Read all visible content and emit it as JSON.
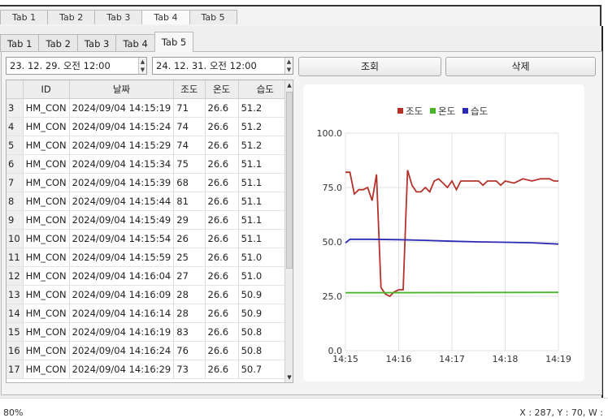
{
  "bg_tabs": [
    "Tab 1",
    "Tab 2",
    "Tab 3",
    "Tab 4",
    "Tab 5"
  ],
  "tabs": [
    "Tab 1",
    "Tab 2",
    "Tab 3",
    "Tab 4",
    "Tab 5"
  ],
  "active_tab": "Tab 5",
  "date_from": "23. 12. 29. 오전 12:00",
  "date_to": "24. 12. 31. 오전 12:00",
  "buttons": {
    "query": "조회",
    "delete": "삭제"
  },
  "table": {
    "columns": [
      "",
      "ID",
      "날짜",
      "조도",
      "온도",
      "습도"
    ],
    "rows": [
      [
        "3",
        "HM_CON",
        "2024/09/04 14:15:19",
        "71",
        "26.6",
        "51.2"
      ],
      [
        "4",
        "HM_CON",
        "2024/09/04 14:15:24",
        "74",
        "26.6",
        "51.2"
      ],
      [
        "5",
        "HM_CON",
        "2024/09/04 14:15:29",
        "74",
        "26.6",
        "51.2"
      ],
      [
        "6",
        "HM_CON",
        "2024/09/04 14:15:34",
        "75",
        "26.6",
        "51.1"
      ],
      [
        "7",
        "HM_CON",
        "2024/09/04 14:15:39",
        "68",
        "26.6",
        "51.1"
      ],
      [
        "8",
        "HM_CON",
        "2024/09/04 14:15:44",
        "81",
        "26.6",
        "51.1"
      ],
      [
        "9",
        "HM_CON",
        "2024/09/04 14:15:49",
        "29",
        "26.6",
        "51.1"
      ],
      [
        "10",
        "HM_CON",
        "2024/09/04 14:15:54",
        "26",
        "26.6",
        "51.1"
      ],
      [
        "11",
        "HM_CON",
        "2024/09/04 14:15:59",
        "25",
        "26.6",
        "51.0"
      ],
      [
        "12",
        "HM_CON",
        "2024/09/04 14:16:04",
        "27",
        "26.6",
        "51.0"
      ],
      [
        "13",
        "HM_CON",
        "2024/09/04 14:16:09",
        "28",
        "26.6",
        "50.9"
      ],
      [
        "14",
        "HM_CON",
        "2024/09/04 14:16:14",
        "28",
        "26.6",
        "50.9"
      ],
      [
        "15",
        "HM_CON",
        "2024/09/04 14:16:19",
        "83",
        "26.6",
        "50.8"
      ],
      [
        "16",
        "HM_CON",
        "2024/09/04 14:16:24",
        "76",
        "26.6",
        "50.8"
      ],
      [
        "17",
        "HM_CON",
        "2024/09/04 14:16:29",
        "73",
        "26.6",
        "50.7"
      ]
    ]
  },
  "chart_data": {
    "type": "line",
    "legend_position": "top",
    "xlim": [
      "14:15",
      "14:19"
    ],
    "ylim": [
      0,
      100
    ],
    "x_ticks": [
      "14:15",
      "14:16",
      "14:17",
      "14:18",
      "14:19"
    ],
    "y_ticks": [
      "0.0",
      "25.0",
      "50.0",
      "75.0",
      "100.0"
    ],
    "grid": true,
    "series": [
      {
        "name": "조도",
        "color": "#b5322a",
        "points": [
          [
            "14:15:00",
            82
          ],
          [
            "14:15:05",
            82
          ],
          [
            "14:15:10",
            72
          ],
          [
            "14:15:15",
            74
          ],
          [
            "14:15:20",
            74
          ],
          [
            "14:15:25",
            75
          ],
          [
            "14:15:30",
            69
          ],
          [
            "14:15:35",
            81
          ],
          [
            "14:15:40",
            29
          ],
          [
            "14:15:45",
            26
          ],
          [
            "14:15:50",
            25
          ],
          [
            "14:15:55",
            27
          ],
          [
            "14:16:00",
            28
          ],
          [
            "14:16:05",
            28
          ],
          [
            "14:16:10",
            83
          ],
          [
            "14:16:15",
            76
          ],
          [
            "14:16:20",
            73
          ],
          [
            "14:16:25",
            73
          ],
          [
            "14:16:30",
            75
          ],
          [
            "14:16:35",
            73
          ],
          [
            "14:16:40",
            78
          ],
          [
            "14:16:45",
            79
          ],
          [
            "14:16:50",
            77
          ],
          [
            "14:16:55",
            75
          ],
          [
            "14:17:00",
            78
          ],
          [
            "14:17:05",
            74
          ],
          [
            "14:17:10",
            78
          ],
          [
            "14:17:15",
            78
          ],
          [
            "14:17:20",
            78
          ],
          [
            "14:17:30",
            78
          ],
          [
            "14:17:35",
            76
          ],
          [
            "14:17:40",
            78
          ],
          [
            "14:17:50",
            78
          ],
          [
            "14:17:55",
            76
          ],
          [
            "14:18:00",
            78
          ],
          [
            "14:18:10",
            77
          ],
          [
            "14:18:20",
            79
          ],
          [
            "14:18:30",
            78
          ],
          [
            "14:18:40",
            79
          ],
          [
            "14:18:50",
            79
          ],
          [
            "14:18:55",
            78
          ],
          [
            "14:19:00",
            78
          ]
        ]
      },
      {
        "name": "온도",
        "color": "#4ab52a",
        "points": [
          [
            "14:15:00",
            26.6
          ],
          [
            "14:19:00",
            26.8
          ]
        ]
      },
      {
        "name": "습도",
        "color": "#2a2ab5",
        "points": [
          [
            "14:15:00",
            49.5
          ],
          [
            "14:15:05",
            51.2
          ],
          [
            "14:15:30",
            51.2
          ],
          [
            "14:16:00",
            51.0
          ],
          [
            "14:16:30",
            50.7
          ],
          [
            "14:17:00",
            50.3
          ],
          [
            "14:17:30",
            50.0
          ],
          [
            "14:18:00",
            49.8
          ],
          [
            "14:18:30",
            49.6
          ],
          [
            "14:19:00",
            49.0
          ]
        ]
      }
    ]
  },
  "status": {
    "zoom": "80%",
    "coords": "X : 287, Y : 70, W :"
  }
}
